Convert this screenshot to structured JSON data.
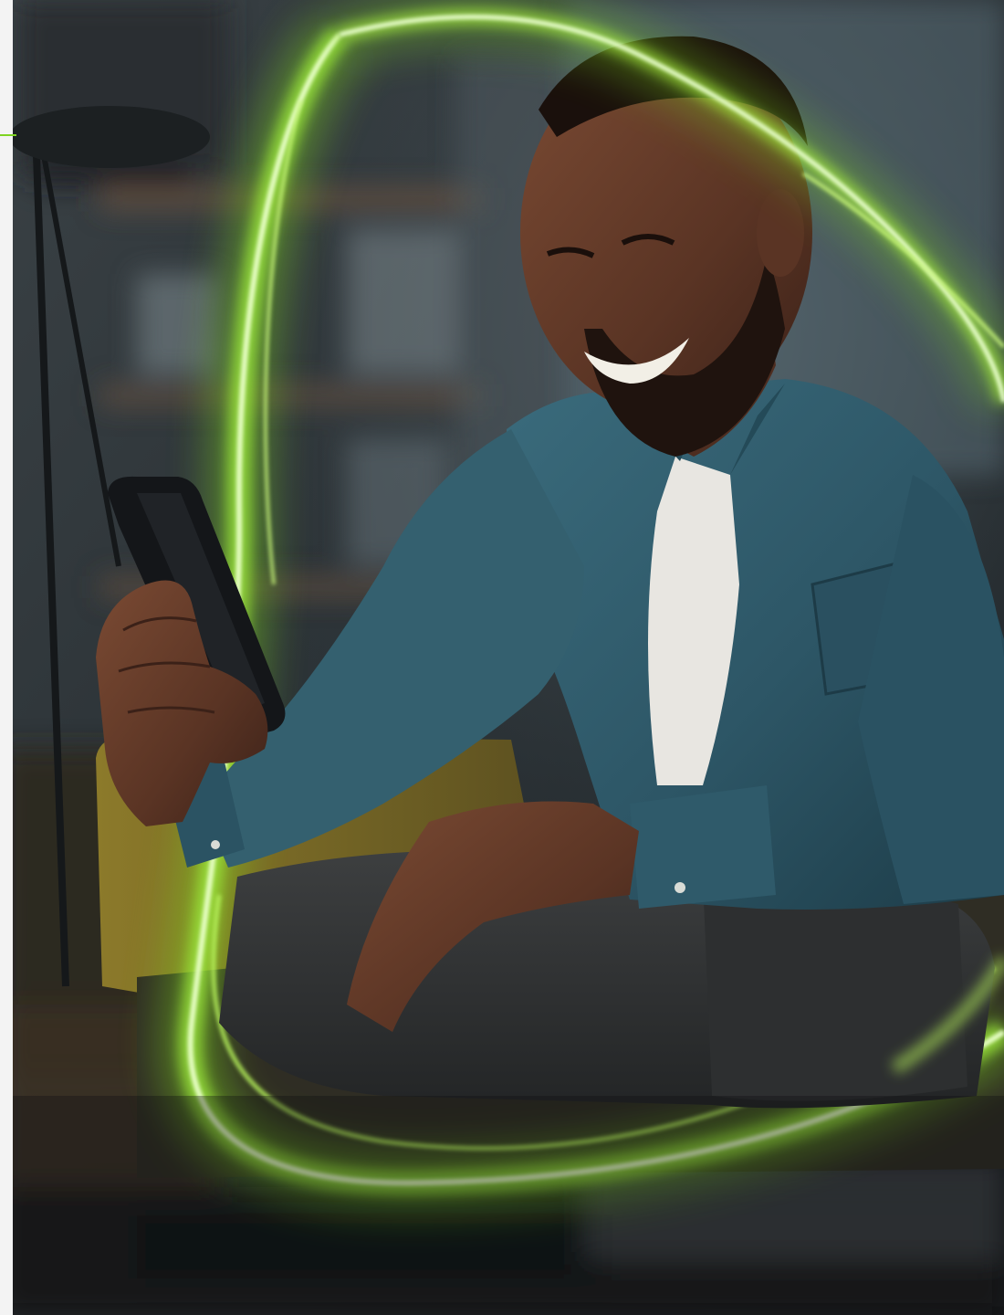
{
  "photo": {
    "subject": "smiling-man-using-smartphone",
    "effect": "green-light-trail-swirl"
  },
  "colors": {
    "accent": "#7ed321",
    "glow": "#a8f040",
    "shirt": "#2f5868",
    "background": "#2c3236"
  }
}
